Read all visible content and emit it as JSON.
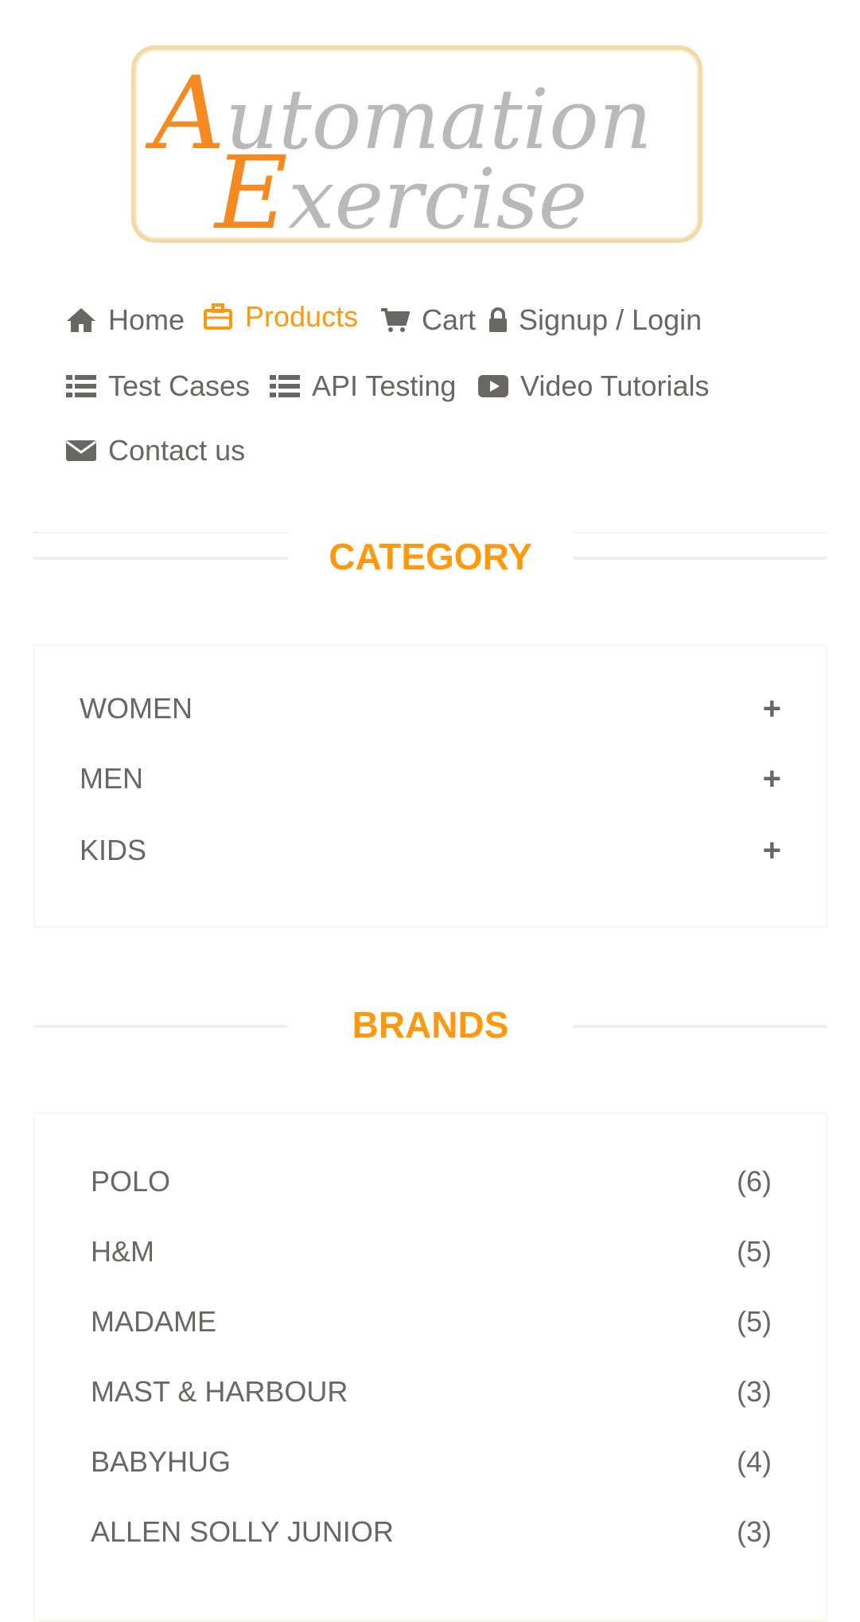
{
  "logo": {
    "line1_cap": "A",
    "line1_rest": "utomation",
    "line2_cap": "E",
    "line2_rest": "xercise"
  },
  "nav": [
    {
      "label": "Home",
      "icon": "home-icon"
    },
    {
      "label": "Products",
      "icon": "briefcase-icon",
      "active": true
    },
    {
      "label": "Cart",
      "icon": "shopping-cart-icon"
    },
    {
      "label": "Signup / Login",
      "icon": "lock-icon"
    },
    {
      "label": "Test Cases",
      "icon": "list-icon"
    },
    {
      "label": "API Testing",
      "icon": "list-icon"
    },
    {
      "label": "Video Tutorials",
      "icon": "youtube-play-icon"
    },
    {
      "label": "Contact us",
      "icon": "envelope-icon"
    }
  ],
  "category": {
    "title": "CATEGORY",
    "items": [
      {
        "label": "WOMEN",
        "expand": "+"
      },
      {
        "label": "MEN",
        "expand": "+"
      },
      {
        "label": "KIDS",
        "expand": "+"
      }
    ]
  },
  "brands": {
    "title": "BRANDS",
    "items": [
      {
        "label": "POLO",
        "count": "(6)"
      },
      {
        "label": "H&M",
        "count": "(5)"
      },
      {
        "label": "MADAME",
        "count": "(5)"
      },
      {
        "label": "MAST & HARBOUR",
        "count": "(3)"
      },
      {
        "label": "BABYHUG",
        "count": "(4)"
      },
      {
        "label": "ALLEN SOLLY JUNIOR",
        "count": "(3)"
      }
    ]
  },
  "colors": {
    "accent": "#fe980f",
    "text": "#696763",
    "logo_border": "#f3d9a6"
  }
}
